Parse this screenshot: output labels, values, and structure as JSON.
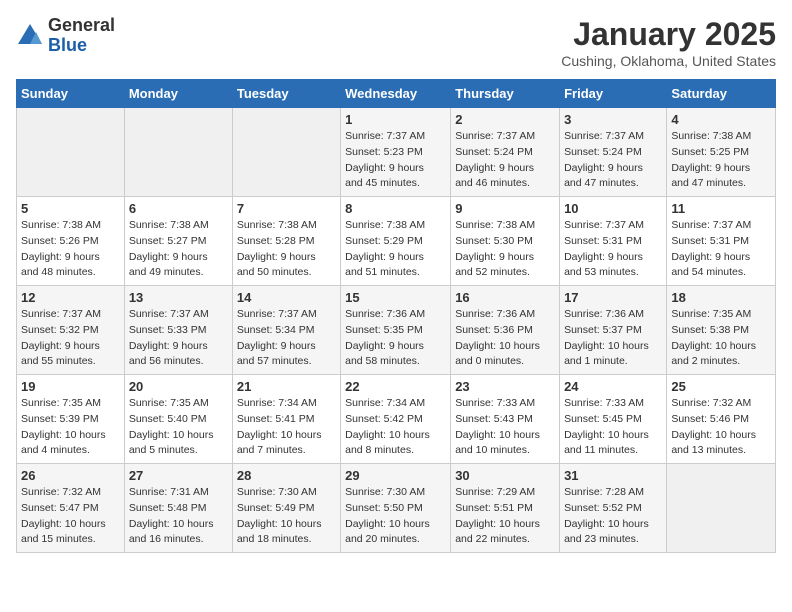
{
  "logo": {
    "general": "General",
    "blue": "Blue"
  },
  "title": "January 2025",
  "location": "Cushing, Oklahoma, United States",
  "weekdays": [
    "Sunday",
    "Monday",
    "Tuesday",
    "Wednesday",
    "Thursday",
    "Friday",
    "Saturday"
  ],
  "weeks": [
    [
      {
        "day": "",
        "detail": ""
      },
      {
        "day": "",
        "detail": ""
      },
      {
        "day": "",
        "detail": ""
      },
      {
        "day": "1",
        "detail": "Sunrise: 7:37 AM\nSunset: 5:23 PM\nDaylight: 9 hours\nand 45 minutes."
      },
      {
        "day": "2",
        "detail": "Sunrise: 7:37 AM\nSunset: 5:24 PM\nDaylight: 9 hours\nand 46 minutes."
      },
      {
        "day": "3",
        "detail": "Sunrise: 7:37 AM\nSunset: 5:24 PM\nDaylight: 9 hours\nand 47 minutes."
      },
      {
        "day": "4",
        "detail": "Sunrise: 7:38 AM\nSunset: 5:25 PM\nDaylight: 9 hours\nand 47 minutes."
      }
    ],
    [
      {
        "day": "5",
        "detail": "Sunrise: 7:38 AM\nSunset: 5:26 PM\nDaylight: 9 hours\nand 48 minutes."
      },
      {
        "day": "6",
        "detail": "Sunrise: 7:38 AM\nSunset: 5:27 PM\nDaylight: 9 hours\nand 49 minutes."
      },
      {
        "day": "7",
        "detail": "Sunrise: 7:38 AM\nSunset: 5:28 PM\nDaylight: 9 hours\nand 50 minutes."
      },
      {
        "day": "8",
        "detail": "Sunrise: 7:38 AM\nSunset: 5:29 PM\nDaylight: 9 hours\nand 51 minutes."
      },
      {
        "day": "9",
        "detail": "Sunrise: 7:38 AM\nSunset: 5:30 PM\nDaylight: 9 hours\nand 52 minutes."
      },
      {
        "day": "10",
        "detail": "Sunrise: 7:37 AM\nSunset: 5:31 PM\nDaylight: 9 hours\nand 53 minutes."
      },
      {
        "day": "11",
        "detail": "Sunrise: 7:37 AM\nSunset: 5:31 PM\nDaylight: 9 hours\nand 54 minutes."
      }
    ],
    [
      {
        "day": "12",
        "detail": "Sunrise: 7:37 AM\nSunset: 5:32 PM\nDaylight: 9 hours\nand 55 minutes."
      },
      {
        "day": "13",
        "detail": "Sunrise: 7:37 AM\nSunset: 5:33 PM\nDaylight: 9 hours\nand 56 minutes."
      },
      {
        "day": "14",
        "detail": "Sunrise: 7:37 AM\nSunset: 5:34 PM\nDaylight: 9 hours\nand 57 minutes."
      },
      {
        "day": "15",
        "detail": "Sunrise: 7:36 AM\nSunset: 5:35 PM\nDaylight: 9 hours\nand 58 minutes."
      },
      {
        "day": "16",
        "detail": "Sunrise: 7:36 AM\nSunset: 5:36 PM\nDaylight: 10 hours\nand 0 minutes."
      },
      {
        "day": "17",
        "detail": "Sunrise: 7:36 AM\nSunset: 5:37 PM\nDaylight: 10 hours\nand 1 minute."
      },
      {
        "day": "18",
        "detail": "Sunrise: 7:35 AM\nSunset: 5:38 PM\nDaylight: 10 hours\nand 2 minutes."
      }
    ],
    [
      {
        "day": "19",
        "detail": "Sunrise: 7:35 AM\nSunset: 5:39 PM\nDaylight: 10 hours\nand 4 minutes."
      },
      {
        "day": "20",
        "detail": "Sunrise: 7:35 AM\nSunset: 5:40 PM\nDaylight: 10 hours\nand 5 minutes."
      },
      {
        "day": "21",
        "detail": "Sunrise: 7:34 AM\nSunset: 5:41 PM\nDaylight: 10 hours\nand 7 minutes."
      },
      {
        "day": "22",
        "detail": "Sunrise: 7:34 AM\nSunset: 5:42 PM\nDaylight: 10 hours\nand 8 minutes."
      },
      {
        "day": "23",
        "detail": "Sunrise: 7:33 AM\nSunset: 5:43 PM\nDaylight: 10 hours\nand 10 minutes."
      },
      {
        "day": "24",
        "detail": "Sunrise: 7:33 AM\nSunset: 5:45 PM\nDaylight: 10 hours\nand 11 minutes."
      },
      {
        "day": "25",
        "detail": "Sunrise: 7:32 AM\nSunset: 5:46 PM\nDaylight: 10 hours\nand 13 minutes."
      }
    ],
    [
      {
        "day": "26",
        "detail": "Sunrise: 7:32 AM\nSunset: 5:47 PM\nDaylight: 10 hours\nand 15 minutes."
      },
      {
        "day": "27",
        "detail": "Sunrise: 7:31 AM\nSunset: 5:48 PM\nDaylight: 10 hours\nand 16 minutes."
      },
      {
        "day": "28",
        "detail": "Sunrise: 7:30 AM\nSunset: 5:49 PM\nDaylight: 10 hours\nand 18 minutes."
      },
      {
        "day": "29",
        "detail": "Sunrise: 7:30 AM\nSunset: 5:50 PM\nDaylight: 10 hours\nand 20 minutes."
      },
      {
        "day": "30",
        "detail": "Sunrise: 7:29 AM\nSunset: 5:51 PM\nDaylight: 10 hours\nand 22 minutes."
      },
      {
        "day": "31",
        "detail": "Sunrise: 7:28 AM\nSunset: 5:52 PM\nDaylight: 10 hours\nand 23 minutes."
      },
      {
        "day": "",
        "detail": ""
      }
    ]
  ]
}
